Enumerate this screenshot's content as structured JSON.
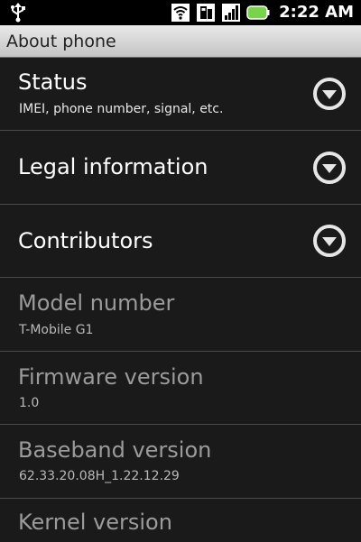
{
  "status_bar": {
    "time": "2:22 AM",
    "icons": [
      "usb-icon",
      "wifi-icon",
      "sim-icon",
      "signal-icon",
      "battery-icon"
    ]
  },
  "header": {
    "title": "About phone"
  },
  "items": [
    {
      "title": "Status",
      "summary": "IMEI, phone number, signal, etc.",
      "enabled": true,
      "expandable": true
    },
    {
      "title": "Legal information",
      "summary": "",
      "enabled": true,
      "expandable": true
    },
    {
      "title": "Contributors",
      "summary": "",
      "enabled": true,
      "expandable": true
    },
    {
      "title": "Model number",
      "summary": "T-Mobile G1",
      "enabled": false,
      "expandable": false
    },
    {
      "title": "Firmware version",
      "summary": "1.0",
      "enabled": false,
      "expandable": false
    },
    {
      "title": "Baseband version",
      "summary": "62.33.20.08H_1.22.12.29",
      "enabled": false,
      "expandable": false
    },
    {
      "title": "Kernel version",
      "summary": "",
      "enabled": false,
      "expandable": false
    }
  ],
  "colors": {
    "background": "#1a1a1a",
    "title_bar": "#d8d8d8",
    "enabled_text": "#ffffff",
    "disabled_text": "#9b9b9b",
    "battery": "#7bd24b"
  }
}
